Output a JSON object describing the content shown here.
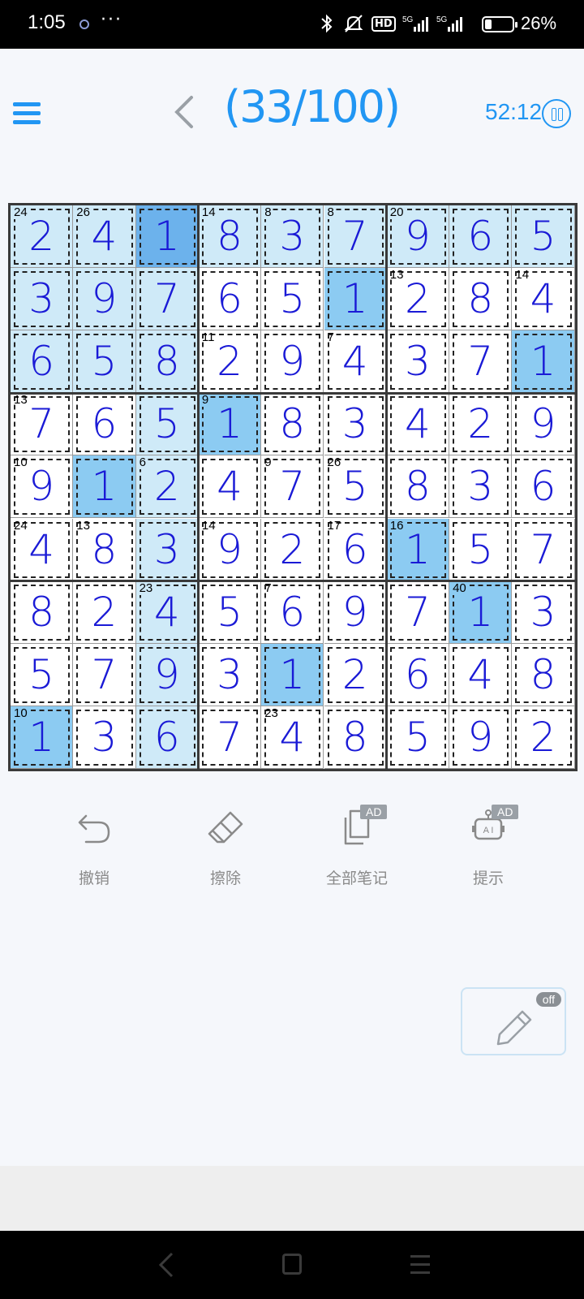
{
  "status_bar": {
    "time": "1:05",
    "more": "···",
    "battery": "26%",
    "network": "5G",
    "hd": "HD"
  },
  "header": {
    "level": "(33/100)",
    "timer": "52:12"
  },
  "board": {
    "digits": [
      [
        2,
        4,
        1,
        8,
        3,
        7,
        9,
        6,
        5
      ],
      [
        3,
        9,
        7,
        6,
        5,
        1,
        2,
        8,
        4
      ],
      [
        6,
        5,
        8,
        2,
        9,
        4,
        3,
        7,
        1
      ],
      [
        7,
        6,
        5,
        1,
        8,
        3,
        4,
        2,
        9
      ],
      [
        9,
        1,
        2,
        4,
        7,
        5,
        8,
        3,
        6
      ],
      [
        4,
        8,
        3,
        9,
        2,
        6,
        1,
        5,
        7
      ],
      [
        8,
        2,
        4,
        5,
        6,
        9,
        7,
        1,
        3
      ],
      [
        5,
        7,
        9,
        3,
        1,
        2,
        6,
        4,
        8
      ],
      [
        1,
        3,
        6,
        7,
        4,
        8,
        5,
        9,
        2
      ]
    ],
    "highlight": [
      [
        1,
        1,
        3,
        1,
        1,
        1,
        1,
        1,
        1
      ],
      [
        1,
        1,
        1,
        0,
        0,
        2,
        0,
        0,
        0
      ],
      [
        1,
        1,
        1,
        0,
        0,
        0,
        0,
        0,
        2
      ],
      [
        0,
        0,
        1,
        2,
        0,
        0,
        0,
        0,
        0
      ],
      [
        0,
        2,
        1,
        0,
        0,
        0,
        0,
        0,
        0
      ],
      [
        0,
        0,
        1,
        0,
        0,
        0,
        2,
        0,
        0
      ],
      [
        0,
        0,
        1,
        0,
        0,
        0,
        0,
        2,
        0
      ],
      [
        0,
        0,
        1,
        0,
        2,
        0,
        0,
        0,
        0
      ],
      [
        2,
        0,
        1,
        0,
        0,
        0,
        0,
        0,
        0
      ]
    ],
    "cage_sums": [
      {
        "r": 0,
        "c": 0,
        "sum": "24"
      },
      {
        "r": 0,
        "c": 1,
        "sum": "26"
      },
      {
        "r": 0,
        "c": 3,
        "sum": "14"
      },
      {
        "r": 0,
        "c": 4,
        "sum": "8"
      },
      {
        "r": 0,
        "c": 5,
        "sum": "8"
      },
      {
        "r": 0,
        "c": 6,
        "sum": "20"
      },
      {
        "r": 1,
        "c": 6,
        "sum": "13"
      },
      {
        "r": 1,
        "c": 8,
        "sum": "14"
      },
      {
        "r": 2,
        "c": 3,
        "sum": "11"
      },
      {
        "r": 2,
        "c": 5,
        "sum": "7"
      },
      {
        "r": 3,
        "c": 0,
        "sum": "13"
      },
      {
        "r": 3,
        "c": 3,
        "sum": "9"
      },
      {
        "r": 4,
        "c": 0,
        "sum": "10"
      },
      {
        "r": 4,
        "c": 2,
        "sum": "6"
      },
      {
        "r": 4,
        "c": 4,
        "sum": "9"
      },
      {
        "r": 4,
        "c": 5,
        "sum": "26"
      },
      {
        "r": 5,
        "c": 0,
        "sum": "24"
      },
      {
        "r": 5,
        "c": 1,
        "sum": "13"
      },
      {
        "r": 5,
        "c": 3,
        "sum": "14"
      },
      {
        "r": 5,
        "c": 5,
        "sum": "17"
      },
      {
        "r": 5,
        "c": 6,
        "sum": "16"
      },
      {
        "r": 6,
        "c": 2,
        "sum": "23"
      },
      {
        "r": 6,
        "c": 4,
        "sum": "7"
      },
      {
        "r": 6,
        "c": 7,
        "sum": "40"
      },
      {
        "r": 8,
        "c": 0,
        "sum": "10"
      },
      {
        "r": 8,
        "c": 4,
        "sum": "23"
      }
    ]
  },
  "tools": {
    "undo": "撤销",
    "erase": "擦除",
    "all_notes": "全部笔记",
    "hint": "提示",
    "ad_badge": "AD"
  },
  "pencil": {
    "state": "off"
  },
  "colors": {
    "accent": "#2196f3",
    "digit": "#1a1ad6",
    "light_highlight": "#cfeaf8",
    "mid_highlight": "#8ccbf2",
    "selected": "#6cb2ec"
  }
}
